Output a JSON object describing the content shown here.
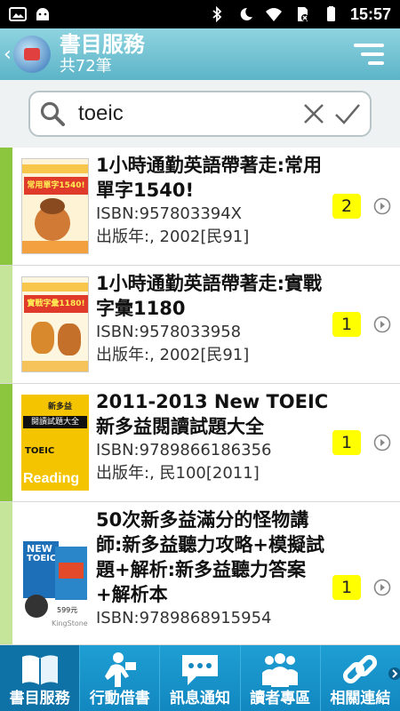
{
  "status": {
    "time": "15:57"
  },
  "header": {
    "title": "書目服務",
    "subtitle": "共72筆"
  },
  "search": {
    "value": "toeic"
  },
  "results": [
    {
      "title": "1小時通勤英語帶著走:常用單字1540!",
      "isbn": "ISBN:957803394X",
      "year": "出版年:, 2002[民91]",
      "count": "2",
      "bar_color": "#8cc63f"
    },
    {
      "title": "1小時通勤英語帶著走:實戰字彙1180",
      "isbn": "ISBN:9578033958",
      "year": "出版年:, 2002[民91]",
      "count": "1",
      "bar_color": "#c5e59a"
    },
    {
      "title": "2011-2013 New TOEIC 新多益閱讀試題大全",
      "isbn": "ISBN:9789866186356",
      "year": "出版年:, 民100[2011]",
      "count": "1",
      "bar_color": "#8cc63f"
    },
    {
      "title": "50次新多益滿分的怪物講師:新多益聽力攻略+模擬試題+解析:新多益聽力答案+解析本",
      "isbn": "ISBN:9789868915954",
      "year": "",
      "count": "1",
      "bar_color": "#c5e59a"
    }
  ],
  "covers": {
    "cover1_label": "常用單字1540!",
    "cover2_label": "實戰字彙1180!",
    "cover3_top": "新多益",
    "cover3_banner": "閱讀試題大全",
    "cover3_toeic": "TOEIC",
    "cover3_reading": "Reading",
    "cover4_new1": "NEW",
    "cover4_toeic1": "TOEIC",
    "cover4_price": "599元",
    "cover4_brand": "KingStone"
  },
  "nav": [
    {
      "label": "書目服務",
      "icon": "book-icon",
      "active": true
    },
    {
      "label": "行動借書",
      "icon": "reader-icon",
      "active": false
    },
    {
      "label": "訊息通知",
      "icon": "chat-icon",
      "active": false
    },
    {
      "label": "讀者專區",
      "icon": "users-icon",
      "active": false
    },
    {
      "label": "相關連結",
      "icon": "link-icon",
      "active": false
    }
  ],
  "colors": {
    "header": "#6cc0d2",
    "nav": "#1a95cc",
    "badge": "#ffff00"
  }
}
